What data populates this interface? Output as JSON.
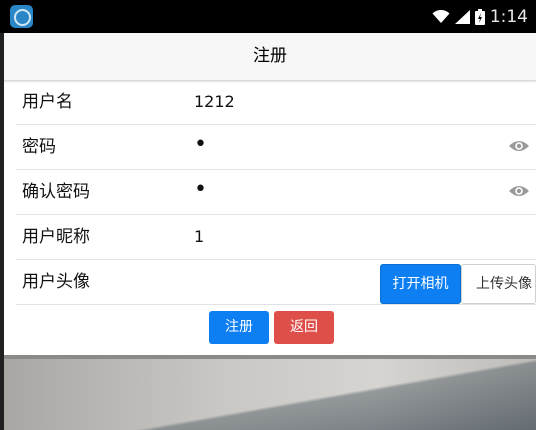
{
  "status_bar": {
    "time": "1:14",
    "icons": [
      "app-icon",
      "wifi-icon",
      "signal-icon",
      "battery-icon"
    ]
  },
  "nav": {
    "title": "注册"
  },
  "form": {
    "username": {
      "label": "用户名",
      "value": "1212"
    },
    "password": {
      "label": "密码",
      "value": "•"
    },
    "confirm_password": {
      "label": "确认密码",
      "value": "•"
    },
    "nickname": {
      "label": "用户昵称",
      "value": "1"
    },
    "avatar": {
      "label": "用户头像",
      "camera_button": "打开相机",
      "upload_button": "上传头像"
    }
  },
  "actions": {
    "register_button": "注册",
    "back_button": "返回"
  },
  "colors": {
    "primary": "#0d7ff3",
    "danger": "#df4f4a",
    "nav_background": "#f7f7f7",
    "status_bar": "#000000"
  }
}
